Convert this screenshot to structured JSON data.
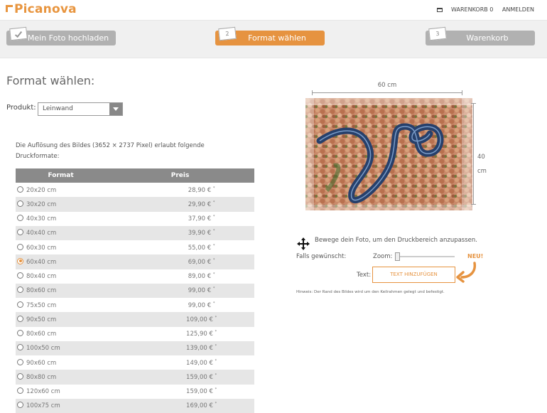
{
  "header": {
    "logo": "Picanova",
    "cart_label": "WARENKORB 0",
    "login_label": "ANMELDEN"
  },
  "steps": [
    {
      "badge": "",
      "label": "Mein Foto hochladen"
    },
    {
      "badge": "2",
      "label": "Format wählen"
    },
    {
      "badge": "3",
      "label": "Warenkorb"
    }
  ],
  "main": {
    "title": "Format wählen:",
    "product_label": "Produkt:",
    "product_value": "Leinwand",
    "resolution_info": "Die Auflösung des Bildes (3652 × 2737 Pixel) erlaubt folgende Druckformate:"
  },
  "table": {
    "headers": {
      "format": "Format",
      "price": "Preis"
    },
    "selected_index": 5,
    "rows": [
      {
        "format": "20x20 cm",
        "price": "28,90 €"
      },
      {
        "format": "30x20 cm",
        "price": "29,90 €"
      },
      {
        "format": "40x30 cm",
        "price": "37,90 €"
      },
      {
        "format": "40x40 cm",
        "price": "39,90 €"
      },
      {
        "format": "60x30 cm",
        "price": "55,00 €"
      },
      {
        "format": "60x40 cm",
        "price": "69,00 €"
      },
      {
        "format": "80x40 cm",
        "price": "89,00 €"
      },
      {
        "format": "80x60 cm",
        "price": "99,00 €"
      },
      {
        "format": "75x50 cm",
        "price": "99,00 €"
      },
      {
        "format": "90x50 cm",
        "price": "109,00 €"
      },
      {
        "format": "80x60 cm",
        "price": "125,90 €"
      },
      {
        "format": "100x50 cm",
        "price": "139,00 €"
      },
      {
        "format": "90x60 cm",
        "price": "149,00 €"
      },
      {
        "format": "80x80 cm",
        "price": "159,00 €"
      },
      {
        "format": "120x60 cm",
        "price": "159,00 €"
      },
      {
        "format": "100x75 cm",
        "price": "169,00 €"
      }
    ],
    "price_suffix": "*"
  },
  "preview": {
    "width_label": "60 cm",
    "height_value": "40",
    "height_unit": "cm",
    "move_text": "Bewege dein Foto, um den Druckbereich anzupassen.",
    "optional_label": "Falls gewünscht:",
    "zoom_label": "Zoom:",
    "new_badge": "NEU!",
    "text_label": "Text:",
    "text_button": "TEXT HINZUFÜGEN",
    "hint": "Hinweis: Der Rand des Bildes wird um den Keilrahmen gelegt und befestigt."
  },
  "colors": {
    "accent": "#e69340",
    "step_inactive": "#b1b1b1",
    "table_header": "#8a8a8a"
  }
}
